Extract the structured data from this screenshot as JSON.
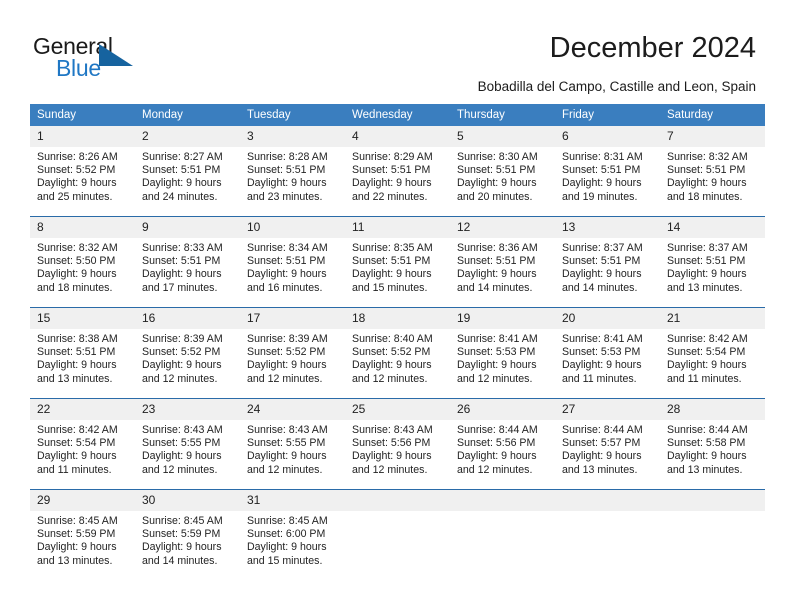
{
  "brand": {
    "name_primary": "General",
    "name_secondary": "Blue",
    "primary_color": "#1a1a1a",
    "secondary_color": "#1f77c4",
    "triangle_color": "#16639f"
  },
  "header": {
    "title": "December 2024",
    "subtitle": "Bobadilla del Campo, Castille and Leon, Spain"
  },
  "calendar": {
    "header_bg": "#3a7ebf",
    "header_text_color": "#ffffff",
    "row_divider_color": "#2a6ba8",
    "date_band_bg": "#f0f0f0",
    "weekdays": [
      "Sunday",
      "Monday",
      "Tuesday",
      "Wednesday",
      "Thursday",
      "Friday",
      "Saturday"
    ],
    "weeks": [
      [
        {
          "date": "1",
          "sunrise": "Sunrise: 8:26 AM",
          "sunset": "Sunset: 5:52 PM",
          "daylight_line1": "Daylight: 9 hours",
          "daylight_line2": "and 25 minutes."
        },
        {
          "date": "2",
          "sunrise": "Sunrise: 8:27 AM",
          "sunset": "Sunset: 5:51 PM",
          "daylight_line1": "Daylight: 9 hours",
          "daylight_line2": "and 24 minutes."
        },
        {
          "date": "3",
          "sunrise": "Sunrise: 8:28 AM",
          "sunset": "Sunset: 5:51 PM",
          "daylight_line1": "Daylight: 9 hours",
          "daylight_line2": "and 23 minutes."
        },
        {
          "date": "4",
          "sunrise": "Sunrise: 8:29 AM",
          "sunset": "Sunset: 5:51 PM",
          "daylight_line1": "Daylight: 9 hours",
          "daylight_line2": "and 22 minutes."
        },
        {
          "date": "5",
          "sunrise": "Sunrise: 8:30 AM",
          "sunset": "Sunset: 5:51 PM",
          "daylight_line1": "Daylight: 9 hours",
          "daylight_line2": "and 20 minutes."
        },
        {
          "date": "6",
          "sunrise": "Sunrise: 8:31 AM",
          "sunset": "Sunset: 5:51 PM",
          "daylight_line1": "Daylight: 9 hours",
          "daylight_line2": "and 19 minutes."
        },
        {
          "date": "7",
          "sunrise": "Sunrise: 8:32 AM",
          "sunset": "Sunset: 5:51 PM",
          "daylight_line1": "Daylight: 9 hours",
          "daylight_line2": "and 18 minutes."
        }
      ],
      [
        {
          "date": "8",
          "sunrise": "Sunrise: 8:32 AM",
          "sunset": "Sunset: 5:50 PM",
          "daylight_line1": "Daylight: 9 hours",
          "daylight_line2": "and 18 minutes."
        },
        {
          "date": "9",
          "sunrise": "Sunrise: 8:33 AM",
          "sunset": "Sunset: 5:51 PM",
          "daylight_line1": "Daylight: 9 hours",
          "daylight_line2": "and 17 minutes."
        },
        {
          "date": "10",
          "sunrise": "Sunrise: 8:34 AM",
          "sunset": "Sunset: 5:51 PM",
          "daylight_line1": "Daylight: 9 hours",
          "daylight_line2": "and 16 minutes."
        },
        {
          "date": "11",
          "sunrise": "Sunrise: 8:35 AM",
          "sunset": "Sunset: 5:51 PM",
          "daylight_line1": "Daylight: 9 hours",
          "daylight_line2": "and 15 minutes."
        },
        {
          "date": "12",
          "sunrise": "Sunrise: 8:36 AM",
          "sunset": "Sunset: 5:51 PM",
          "daylight_line1": "Daylight: 9 hours",
          "daylight_line2": "and 14 minutes."
        },
        {
          "date": "13",
          "sunrise": "Sunrise: 8:37 AM",
          "sunset": "Sunset: 5:51 PM",
          "daylight_line1": "Daylight: 9 hours",
          "daylight_line2": "and 14 minutes."
        },
        {
          "date": "14",
          "sunrise": "Sunrise: 8:37 AM",
          "sunset": "Sunset: 5:51 PM",
          "daylight_line1": "Daylight: 9 hours",
          "daylight_line2": "and 13 minutes."
        }
      ],
      [
        {
          "date": "15",
          "sunrise": "Sunrise: 8:38 AM",
          "sunset": "Sunset: 5:51 PM",
          "daylight_line1": "Daylight: 9 hours",
          "daylight_line2": "and 13 minutes."
        },
        {
          "date": "16",
          "sunrise": "Sunrise: 8:39 AM",
          "sunset": "Sunset: 5:52 PM",
          "daylight_line1": "Daylight: 9 hours",
          "daylight_line2": "and 12 minutes."
        },
        {
          "date": "17",
          "sunrise": "Sunrise: 8:39 AM",
          "sunset": "Sunset: 5:52 PM",
          "daylight_line1": "Daylight: 9 hours",
          "daylight_line2": "and 12 minutes."
        },
        {
          "date": "18",
          "sunrise": "Sunrise: 8:40 AM",
          "sunset": "Sunset: 5:52 PM",
          "daylight_line1": "Daylight: 9 hours",
          "daylight_line2": "and 12 minutes."
        },
        {
          "date": "19",
          "sunrise": "Sunrise: 8:41 AM",
          "sunset": "Sunset: 5:53 PM",
          "daylight_line1": "Daylight: 9 hours",
          "daylight_line2": "and 12 minutes."
        },
        {
          "date": "20",
          "sunrise": "Sunrise: 8:41 AM",
          "sunset": "Sunset: 5:53 PM",
          "daylight_line1": "Daylight: 9 hours",
          "daylight_line2": "and 11 minutes."
        },
        {
          "date": "21",
          "sunrise": "Sunrise: 8:42 AM",
          "sunset": "Sunset: 5:54 PM",
          "daylight_line1": "Daylight: 9 hours",
          "daylight_line2": "and 11 minutes."
        }
      ],
      [
        {
          "date": "22",
          "sunrise": "Sunrise: 8:42 AM",
          "sunset": "Sunset: 5:54 PM",
          "daylight_line1": "Daylight: 9 hours",
          "daylight_line2": "and 11 minutes."
        },
        {
          "date": "23",
          "sunrise": "Sunrise: 8:43 AM",
          "sunset": "Sunset: 5:55 PM",
          "daylight_line1": "Daylight: 9 hours",
          "daylight_line2": "and 12 minutes."
        },
        {
          "date": "24",
          "sunrise": "Sunrise: 8:43 AM",
          "sunset": "Sunset: 5:55 PM",
          "daylight_line1": "Daylight: 9 hours",
          "daylight_line2": "and 12 minutes."
        },
        {
          "date": "25",
          "sunrise": "Sunrise: 8:43 AM",
          "sunset": "Sunset: 5:56 PM",
          "daylight_line1": "Daylight: 9 hours",
          "daylight_line2": "and 12 minutes."
        },
        {
          "date": "26",
          "sunrise": "Sunrise: 8:44 AM",
          "sunset": "Sunset: 5:56 PM",
          "daylight_line1": "Daylight: 9 hours",
          "daylight_line2": "and 12 minutes."
        },
        {
          "date": "27",
          "sunrise": "Sunrise: 8:44 AM",
          "sunset": "Sunset: 5:57 PM",
          "daylight_line1": "Daylight: 9 hours",
          "daylight_line2": "and 13 minutes."
        },
        {
          "date": "28",
          "sunrise": "Sunrise: 8:44 AM",
          "sunset": "Sunset: 5:58 PM",
          "daylight_line1": "Daylight: 9 hours",
          "daylight_line2": "and 13 minutes."
        }
      ],
      [
        {
          "date": "29",
          "sunrise": "Sunrise: 8:45 AM",
          "sunset": "Sunset: 5:59 PM",
          "daylight_line1": "Daylight: 9 hours",
          "daylight_line2": "and 13 minutes."
        },
        {
          "date": "30",
          "sunrise": "Sunrise: 8:45 AM",
          "sunset": "Sunset: 5:59 PM",
          "daylight_line1": "Daylight: 9 hours",
          "daylight_line2": "and 14 minutes."
        },
        {
          "date": "31",
          "sunrise": "Sunrise: 8:45 AM",
          "sunset": "Sunset: 6:00 PM",
          "daylight_line1": "Daylight: 9 hours",
          "daylight_line2": "and 15 minutes."
        },
        {
          "date": "",
          "sunrise": "",
          "sunset": "",
          "daylight_line1": "",
          "daylight_line2": ""
        },
        {
          "date": "",
          "sunrise": "",
          "sunset": "",
          "daylight_line1": "",
          "daylight_line2": ""
        },
        {
          "date": "",
          "sunrise": "",
          "sunset": "",
          "daylight_line1": "",
          "daylight_line2": ""
        },
        {
          "date": "",
          "sunrise": "",
          "sunset": "",
          "daylight_line1": "",
          "daylight_line2": ""
        }
      ]
    ]
  }
}
